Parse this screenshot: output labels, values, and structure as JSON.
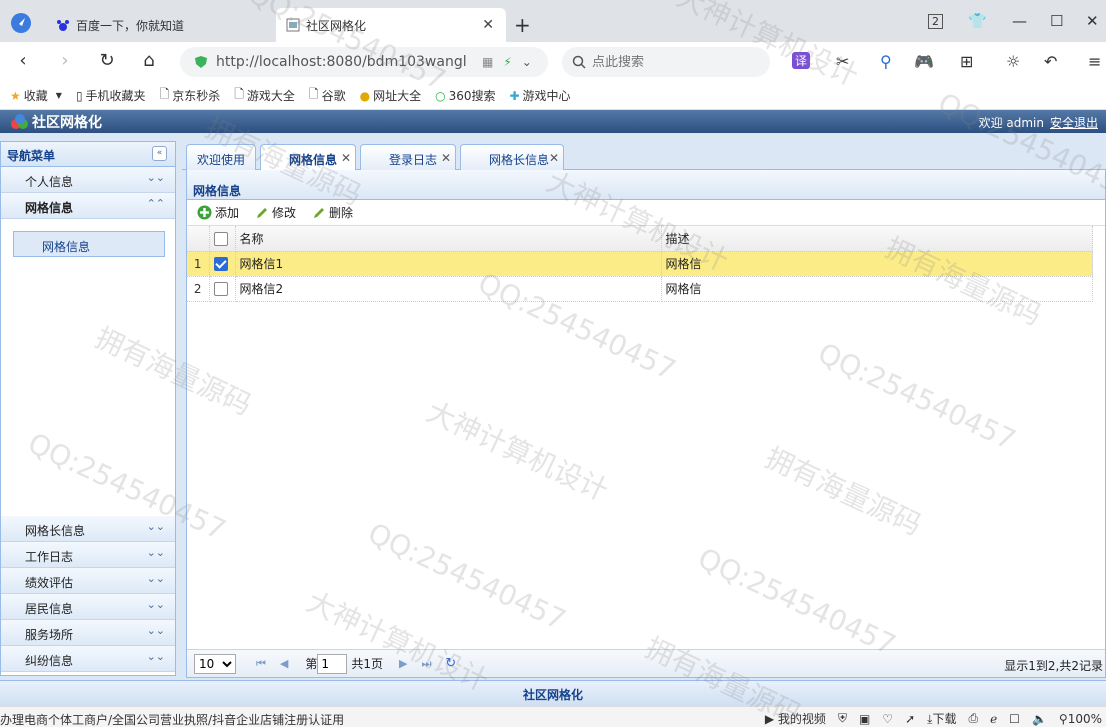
{
  "browser": {
    "tabs": [
      {
        "label": "百度一下，你就知道"
      },
      {
        "label": "社区网格化"
      }
    ],
    "url": "http://localhost:8080/bdm103wangl",
    "search_placeholder": "点此搜索",
    "bookmarks": [
      "收藏",
      "手机收藏夹",
      "京东秒杀",
      "游戏大全",
      "谷歌",
      "网址大全",
      "360搜索",
      "游戏中心"
    ]
  },
  "app": {
    "title": "社区网格化",
    "welcome": "欢迎 admin",
    "logout": "安全退出",
    "footer": "社区网格化"
  },
  "sidebar": {
    "title": "导航菜单",
    "top_items": [
      {
        "label": "个人信息"
      },
      {
        "label": "网格信息"
      }
    ],
    "sub_item": "网格信息",
    "bottom_items": [
      {
        "label": "网格长信息"
      },
      {
        "label": "工作日志"
      },
      {
        "label": "绩效评估"
      },
      {
        "label": "居民信息"
      },
      {
        "label": "服务场所"
      },
      {
        "label": "纠纷信息"
      }
    ]
  },
  "content_tabs": [
    {
      "label": "欢迎使用"
    },
    {
      "label": "网格信息"
    },
    {
      "label": "登录日志"
    },
    {
      "label": "网格长信息"
    }
  ],
  "panel": {
    "title": "网格信息",
    "toolbar": {
      "add": "添加",
      "edit": "修改",
      "delete": "删除"
    },
    "columns": [
      "名称",
      "描述"
    ],
    "rows": [
      {
        "num": "1",
        "name": "网格信1",
        "desc": "网格信"
      },
      {
        "num": "2",
        "name": "网格信2",
        "desc": "网格信"
      }
    ]
  },
  "pager": {
    "page_size": "10",
    "page_prefix": "第",
    "page_value": "1",
    "page_total": "共1页",
    "info": "显示1到2,共2记录"
  },
  "statusbar": {
    "left": "办理电商个体工商户/全国公司营业执照/抖音企业店铺注册认证用",
    "video": "我的视频",
    "download": "下载",
    "zoom": "100%"
  },
  "watermarks": [
    "QQ:254540457",
    "大神计算机设计",
    "拥有海量源码"
  ],
  "colors": {
    "header": "#2c4f80",
    "highlight_row": "#fbec88",
    "border": "#99bbe8"
  }
}
